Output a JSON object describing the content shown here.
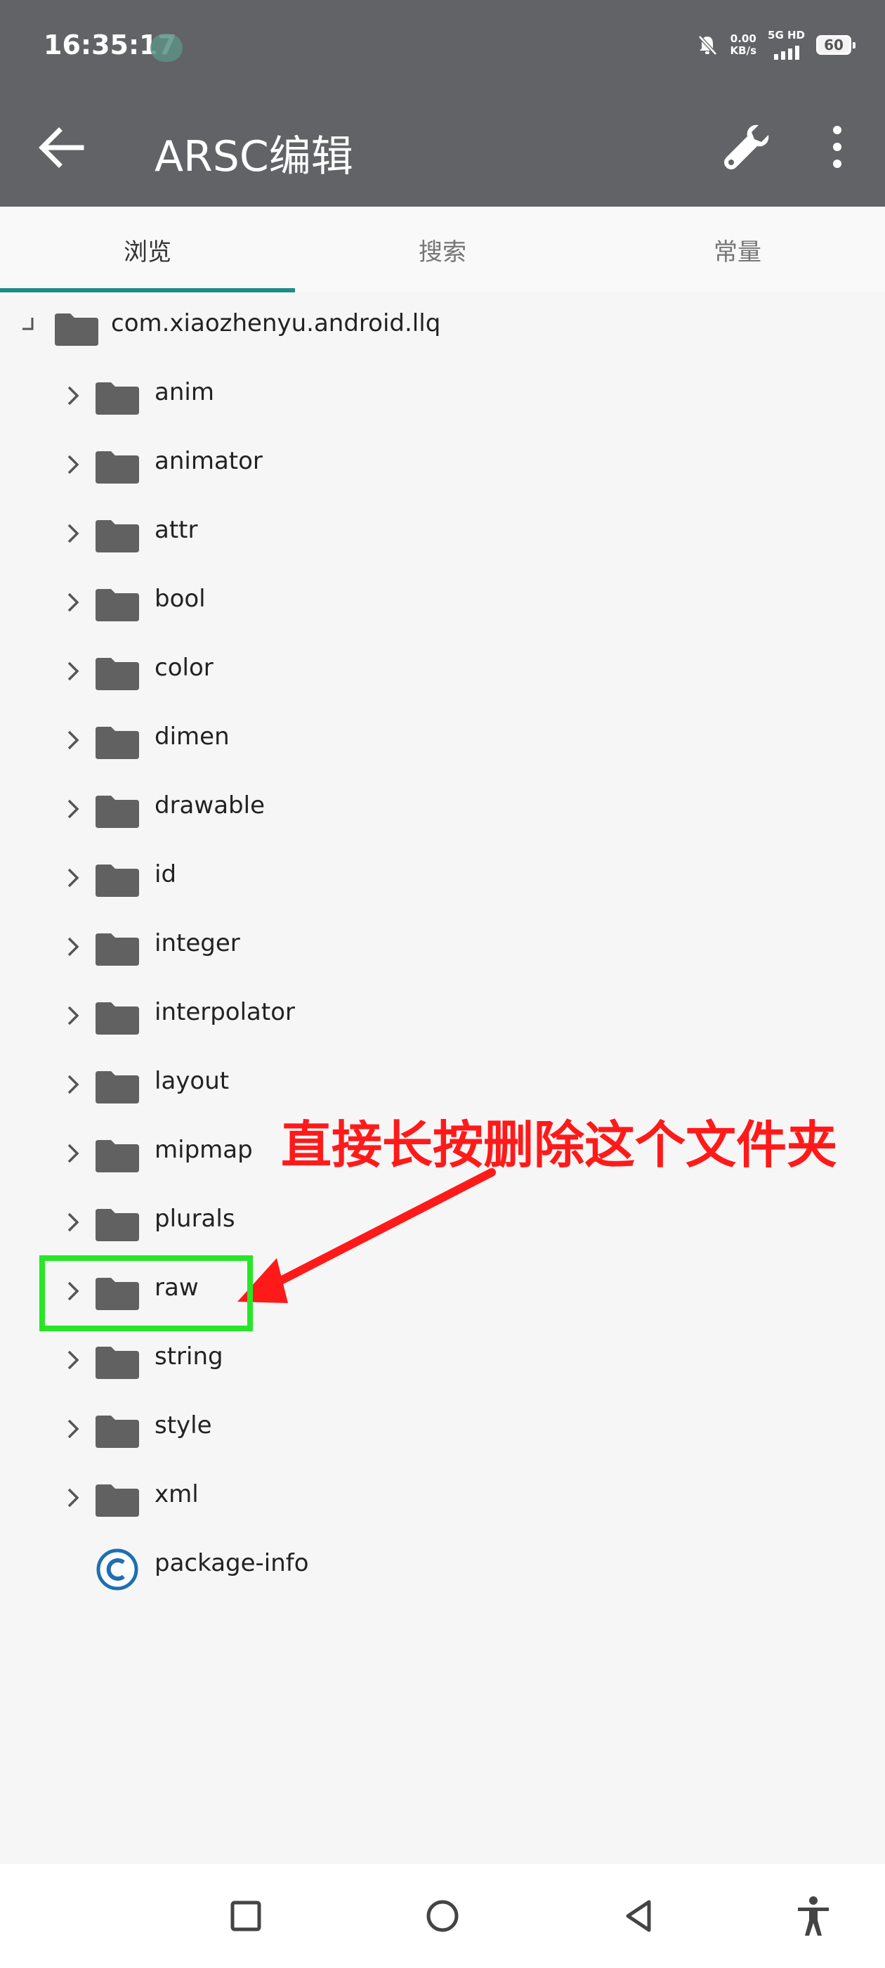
{
  "status_bar": {
    "time": "16:35:17",
    "net_speed_value": "0.00",
    "net_speed_unit": "KB/s",
    "network_label": "5G HD",
    "battery": "60"
  },
  "app_bar": {
    "title": "ARSC编辑",
    "back_icon": "arrow-left-icon",
    "wrench_icon": "wrench-icon",
    "more_icon": "more-vertical-icon"
  },
  "tabs": [
    {
      "label": "浏览",
      "active": true
    },
    {
      "label": "搜索",
      "active": false
    },
    {
      "label": "常量",
      "active": false
    }
  ],
  "tree": {
    "root": "com.xiaozhenyu.android.llq",
    "folders": [
      "anim",
      "animator",
      "attr",
      "bool",
      "color",
      "dimen",
      "drawable",
      "id",
      "integer",
      "interpolator",
      "layout",
      "mipmap",
      "plurals",
      "raw",
      "string",
      "style",
      "xml"
    ],
    "file": "package-info"
  },
  "annotation": {
    "text": "直接长按删除这个文件夹",
    "highlight_color": "#27e627",
    "text_color": "#ff1a1a"
  },
  "colors": {
    "app_bar": "#626366",
    "tab_indicator": "#1e8b86",
    "folder_icon": "#616161",
    "class_icon": "#1f6fb2"
  },
  "nav_bar": [
    "square-recents-icon",
    "circle-home-icon",
    "triangle-back-icon",
    "accessibility-icon"
  ]
}
